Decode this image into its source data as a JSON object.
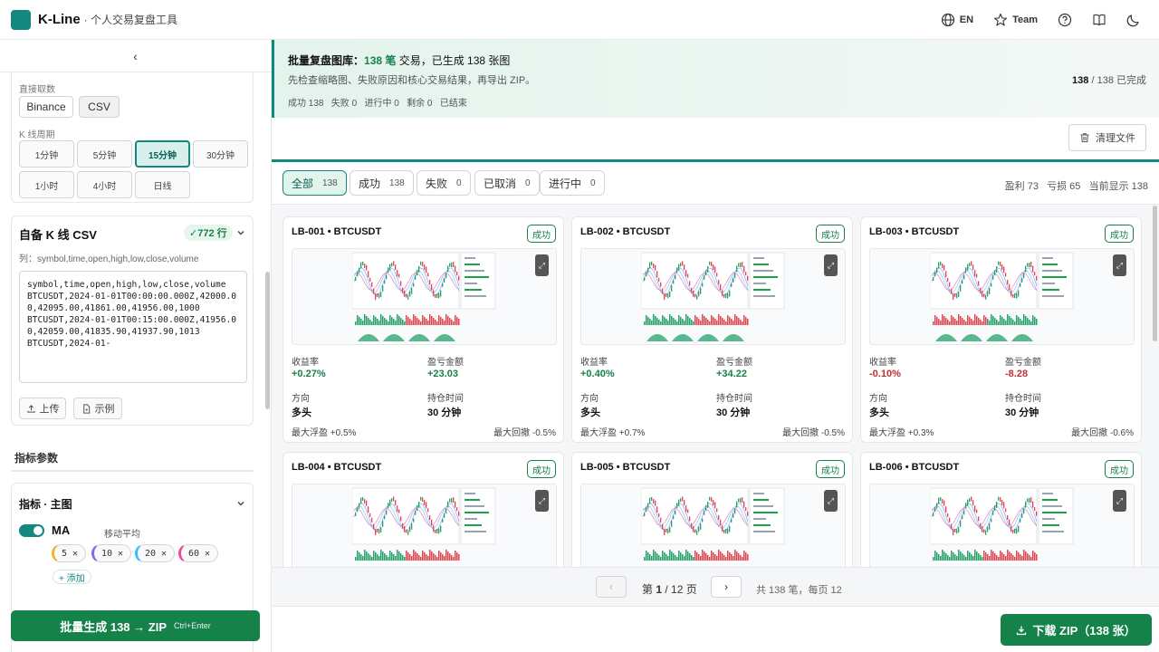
{
  "header": {
    "brand": "K-Line",
    "tagline": "· 个人交易复盘工具",
    "lang_label": "EN",
    "team_label": "Team"
  },
  "sidebar": {
    "source_label": "直接取数",
    "sources": [
      "Binance",
      "CSV"
    ],
    "selected_source": "CSV",
    "period_label": "K 线周期",
    "periods": [
      "1分钟",
      "5分钟",
      "15分钟",
      "30分钟",
      "1小时",
      "4小时",
      "日线"
    ],
    "selected_period": "15分钟",
    "csv": {
      "title": "自备 K 线 CSV",
      "badge": "✓772 行",
      "columns": "列：symbol,time,open,high,low,close,volume",
      "content": "symbol,time,open,high,low,close,volume\nBTCUSDT,2024-01-01T00:00:00.000Z,42000.00,42095.00,41861.00,41956.00,1000\nBTCUSDT,2024-01-01T00:15:00.000Z,41956.00,42059.00,41835.90,41937.90,1013\nBTCUSDT,2024-01-",
      "upload_label": "上传",
      "example_label": "示例"
    },
    "indicator_section_title": "指标参数",
    "indicator_group_title": "指标 · 主图",
    "ma": {
      "name": "MA",
      "desc": "移动平均",
      "periods": [
        "5",
        "10",
        "20",
        "60"
      ],
      "add_label": "+ 添加"
    },
    "generate_button": "批量生成 138 → ZIP",
    "generate_shortcut": "Ctrl+Enter"
  },
  "banner": {
    "title_prefix": "批量复盘图库：",
    "title_num": "138 笔",
    "title_suffix": "交易，已生成 138 张图",
    "subtitle": "先检查缩略图、失败原因和核心交易结果，再导出 ZIP。",
    "status_line": "成功 138   失败 0   进行中 0   剩余 0   已结束",
    "progress_done": "138",
    "progress_rest": "/ 138 已完成"
  },
  "clear_button": "清理文件",
  "tabs": [
    {
      "label": "全部",
      "count": "138"
    },
    {
      "label": "成功",
      "count": "138"
    },
    {
      "label": "失败",
      "count": "0"
    },
    {
      "label": "已取消",
      "count": "0"
    },
    {
      "label": "进行中",
      "count": "0"
    }
  ],
  "tab_stats": "盈利 73   亏损 65   当前显示 138",
  "card_labels": {
    "return": "收益率",
    "pnl": "盈亏金额",
    "direction": "方向",
    "hold": "持仓时间"
  },
  "cards": [
    {
      "id": "LB-001 • BTCUSDT",
      "status": "成功",
      "return": "+0.27%",
      "pnl": "+23.03",
      "direction": "多头",
      "hold": "30 分钟",
      "max_float": "最大浮盈 +0.5%",
      "max_dd": "最大回撤 -0.5%",
      "trend": "up"
    },
    {
      "id": "LB-002 • BTCUSDT",
      "status": "成功",
      "return": "+0.40%",
      "pnl": "+34.22",
      "direction": "多头",
      "hold": "30 分钟",
      "max_float": "最大浮盈 +0.7%",
      "max_dd": "最大回撤 -0.5%",
      "trend": "up"
    },
    {
      "id": "LB-003 • BTCUSDT",
      "status": "成功",
      "return": "-0.10%",
      "pnl": "-8.28",
      "direction": "多头",
      "hold": "30 分钟",
      "max_float": "最大浮盈 +0.3%",
      "max_dd": "最大回撤 -0.6%",
      "trend": "down"
    },
    {
      "id": "LB-004 • BTCUSDT",
      "status": "成功",
      "return": "",
      "pnl": "",
      "direction": "",
      "hold": "",
      "max_float": "",
      "max_dd": "",
      "trend": "up"
    },
    {
      "id": "LB-005 • BTCUSDT",
      "status": "成功",
      "return": "",
      "pnl": "",
      "direction": "",
      "hold": "",
      "max_float": "",
      "max_dd": "",
      "trend": "up"
    },
    {
      "id": "LB-006 • BTCUSDT",
      "status": "成功",
      "return": "",
      "pnl": "",
      "direction": "",
      "hold": "",
      "max_float": "",
      "max_dd": "",
      "trend": "up"
    }
  ],
  "pager": {
    "prev": "‹",
    "next": "›",
    "page_prefix": "第",
    "page_current": "1",
    "page_suffix": "/ 12 页",
    "info": "共 138 笔，每页 12"
  },
  "download_button": "下载 ZIP（138 张）",
  "colors": {
    "accent": "#14877f",
    "primary_button": "#15824a",
    "positive": "#16804a",
    "negative": "#c03030"
  }
}
